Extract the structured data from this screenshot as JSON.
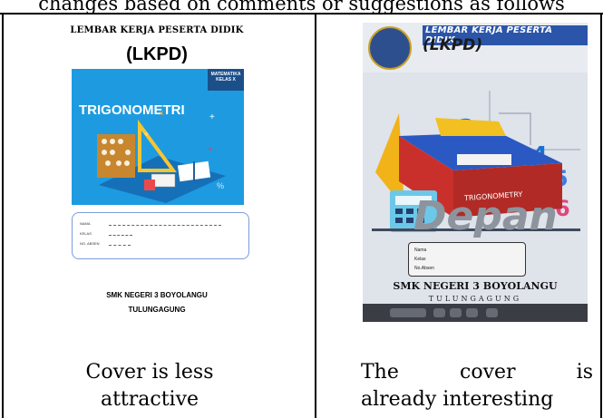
{
  "caption_top": "changes based on comments or suggestions as follows",
  "left_cover": {
    "title_small": "LEMBAR KERJA PESERTA DIDIK",
    "title_big": "(LKPD)",
    "subject_badge_line1": "MATEMATIKA",
    "subject_badge_line2": "KELAS X",
    "topic": "TRIGONOMETRI",
    "form_fields": [
      "NAMA",
      "KELAS",
      "NO. ABSEN"
    ],
    "school": "SMK NEGERI 3 BOYOLANGU",
    "city": "TULUNGAGUNG"
  },
  "right_cover": {
    "title_small": "LEMBAR KERJA PESERTA DIDIK",
    "title_big": "(LKPD)",
    "book_label": "TRIGONOMETRY",
    "overlay_word": "Depan",
    "form_fields": [
      "Nama",
      "Kelas",
      "No.Absen"
    ],
    "school": "SMK NEGERI 3 BOYOLANGU",
    "city": "TULUNGAGUNG"
  },
  "captions": {
    "left": "Cover is less attractive",
    "right_line1": "The cover is",
    "right_line2": "already interesting"
  },
  "colors": {
    "left_banner": "#1e9be0",
    "left_badge": "#1a4f8a",
    "right_title_bg": "#2b55a8",
    "book_red": "#c9302c"
  }
}
